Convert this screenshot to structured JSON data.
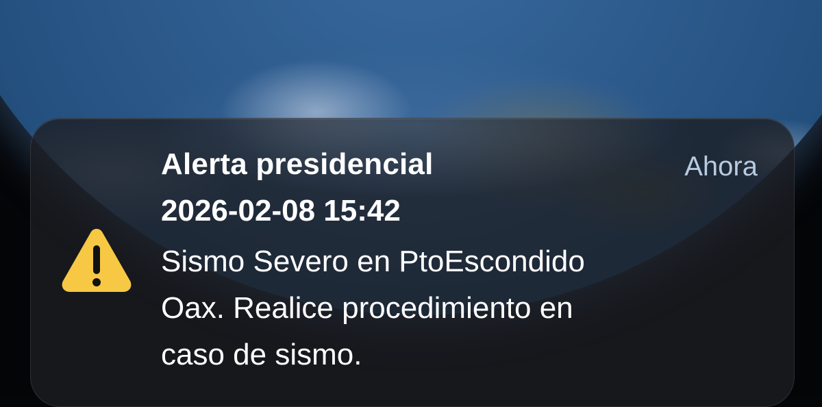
{
  "notification": {
    "title": "Alerta presidencial",
    "datetime": "2026-02-08 15:42",
    "time_label": "Ahora",
    "message_lines": [
      "Sismo Severo en PtoEscondido",
      "Oax. Realice procedimiento en",
      "caso de sismo."
    ],
    "icon": "warning-icon",
    "icon_color": "#f7c843",
    "title_color": "#ffffff",
    "time_label_color": "#b8cbe0"
  },
  "wallpaper": {
    "description_icon": "earth-wallpaper"
  }
}
